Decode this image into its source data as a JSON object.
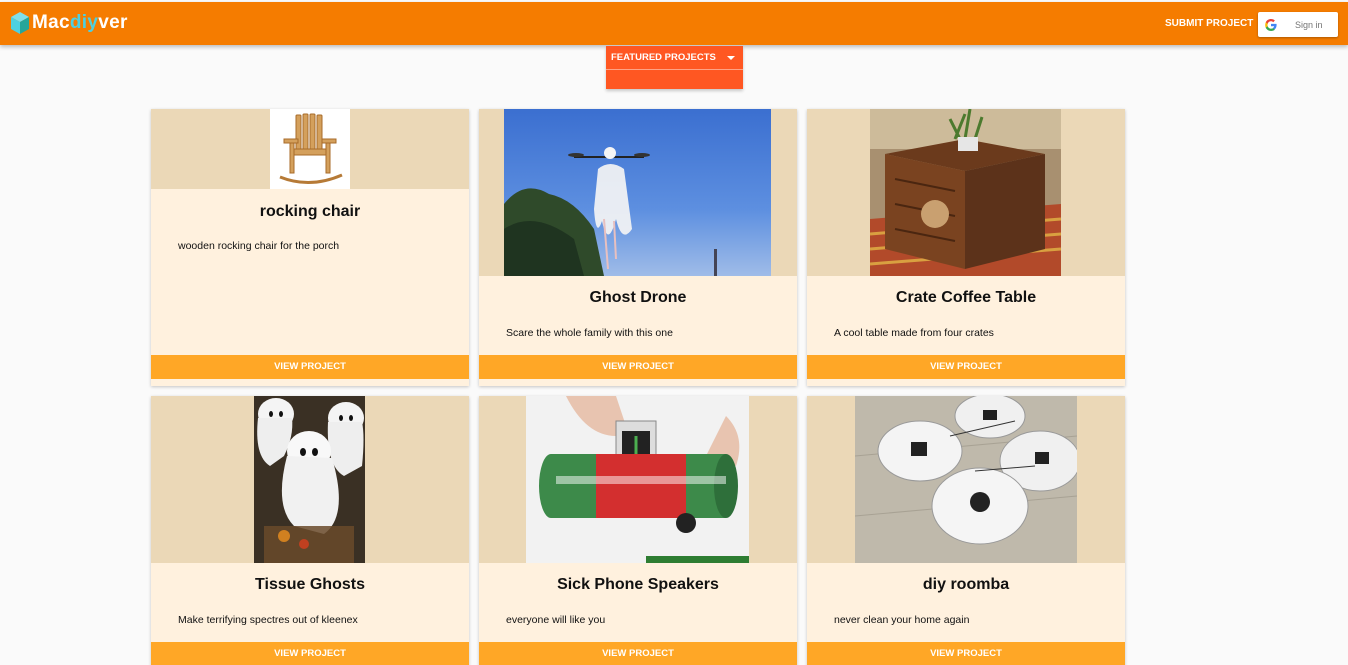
{
  "brand": {
    "name_part1": "Mac",
    "name_accent": "diy",
    "name_part2": "ver",
    "accent_color": "#4dd0e1"
  },
  "header": {
    "submit_label": "SUBMIT PROJECT",
    "signin_label": "Sign in",
    "background": "#f57c00"
  },
  "filter": {
    "label": "FEATURED PROJECTS",
    "icon": "caret-down-icon",
    "background": "#ff5722"
  },
  "projects": [
    {
      "title": "rocking chair",
      "description": "wooden rocking chair for the porch",
      "button": "VIEW PROJECT"
    },
    {
      "title": "Ghost Drone",
      "description": "Scare the whole family with this one",
      "button": "VIEW PROJECT"
    },
    {
      "title": "Crate Coffee Table",
      "description": "A cool table made from four crates",
      "button": "VIEW PROJECT"
    },
    {
      "title": "Tissue Ghosts",
      "description": "Make terrifying spectres out of kleenex",
      "button": "VIEW PROJECT"
    },
    {
      "title": "Sick Phone Speakers",
      "description": "everyone will like you",
      "button": "VIEW PROJECT"
    },
    {
      "title": "diy roomba",
      "description": "never clean your home again",
      "button": "VIEW PROJECT"
    }
  ],
  "colors": {
    "card_background": "#fff1de",
    "media_background": "#ebd8b7",
    "button": "#ffa726"
  }
}
